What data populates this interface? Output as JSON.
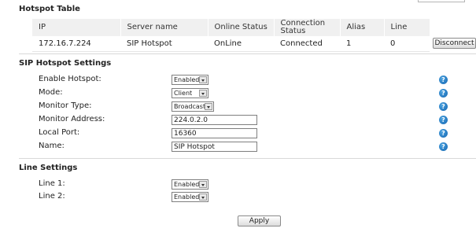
{
  "hotspot_table": {
    "title": "Hotspot Table",
    "headers": [
      "IP",
      "Server name",
      "Online Status",
      "Connection Status",
      "Alias",
      "Line"
    ],
    "rows": [
      [
        "172.16.7.224",
        "SIP Hotspot",
        "OnLine",
        "Connected",
        "1",
        "0"
      ]
    ],
    "disconnect_label": "Disconnect"
  },
  "sip_settings": {
    "title": "SIP Hotspot Settings",
    "enable_label": "Enable Hotspot:",
    "enable_value": "Enabled",
    "mode_label": "Mode:",
    "mode_value": "Client",
    "monitor_type_label": "Monitor Type:",
    "monitor_type_value": "Broadcast",
    "monitor_address_label": "Monitor Address:",
    "monitor_address_value": "224.0.2.0",
    "local_port_label": "Local Port:",
    "local_port_value": "16360",
    "name_label": "Name:",
    "name_value": "SIP Hotspot",
    "help_glyph": "?"
  },
  "line_settings": {
    "title": "Line Settings",
    "line1_label": "Line 1:",
    "line1_value": "Enabled",
    "line2_label": "Line 2:",
    "line2_value": "Enabled"
  },
  "apply_label": "Apply",
  "colors": {
    "header_bg": "#f0f0f0",
    "help_blue": "#1e7fd0"
  }
}
